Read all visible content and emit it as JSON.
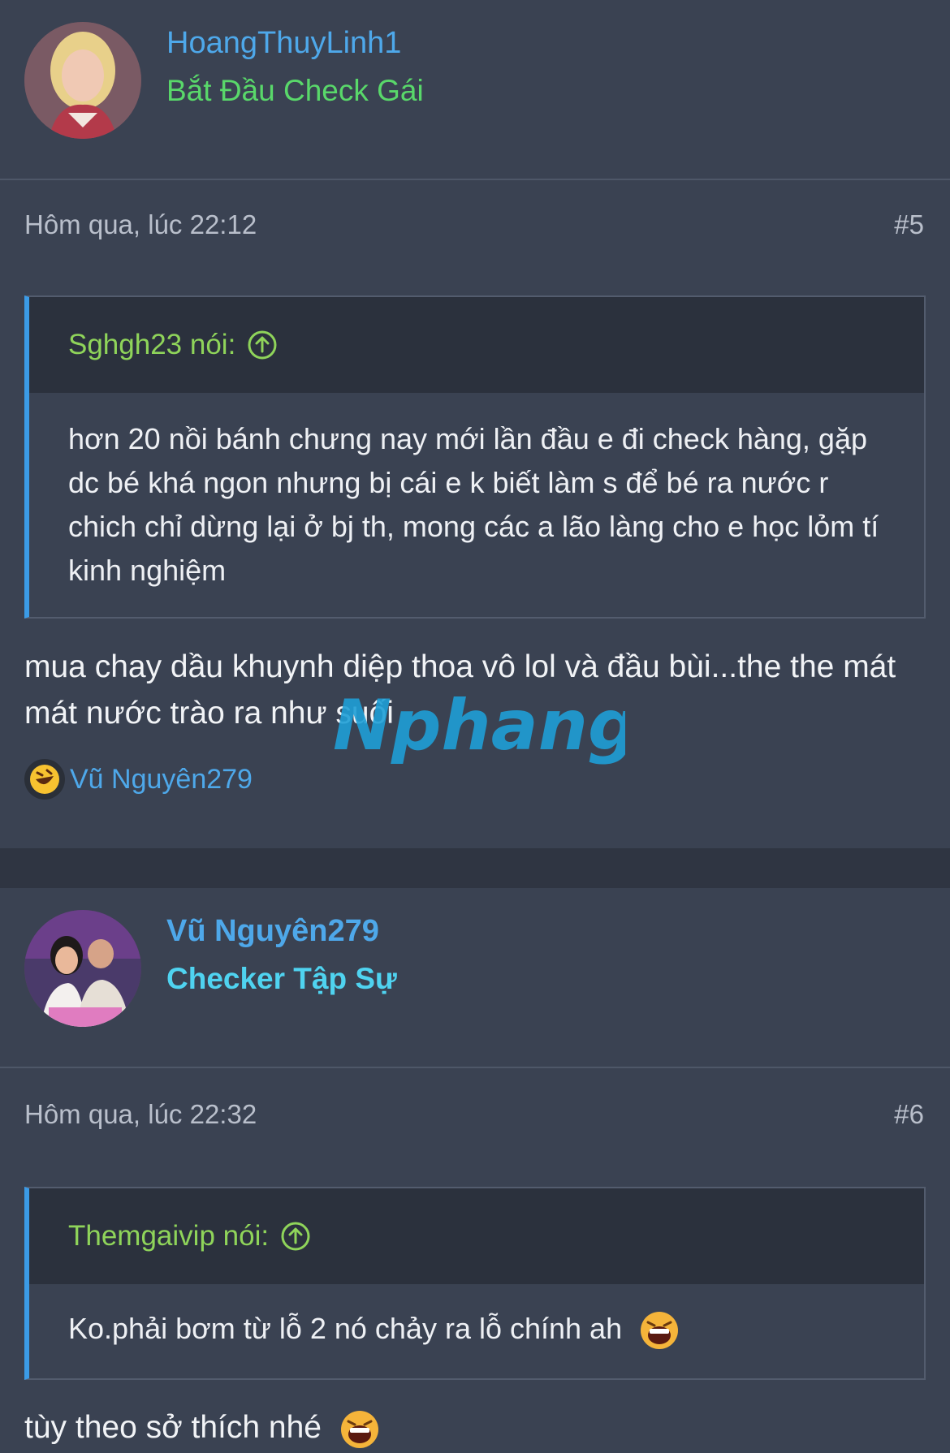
{
  "posts": [
    {
      "author": "HoangThuyLinh1",
      "user_title": "Bắt Đầu Check Gái",
      "date": "Hôm qua, lúc 22:12",
      "number": "#5",
      "quote": {
        "author_label": "Sghgh23 nói:",
        "text": "hơn 20 nồi bánh chưng nay mới lần đầu e đi check hàng, gặp dc bé khá ngon nhưng bị cái e k biết làm s để bé ra nước r chich chỉ dừng lại ở bj th, mong các a lão làng cho e học lỏm tí kinh nghiệm"
      },
      "body": "mua chay dầu khuynh diệp thoa vô lol và đầu bùi...the the mát mát nước trào ra như suối",
      "reaction_user": "Vũ Nguyên279"
    },
    {
      "author": "Vũ Nguyên279",
      "user_title": "Checker Tập Sự",
      "date": "Hôm qua, lúc 22:32",
      "number": "#6",
      "quote": {
        "author_label": "Themgaivip nói:",
        "text": "Ko.phải bơm từ lỗ 2 nó chảy ra lỗ chính ah"
      },
      "body": "tùy theo sở thích nhé"
    }
  ],
  "watermark": "Nphang",
  "colors": {
    "username": "#4ea8ea",
    "quote_author": "#8fd45a",
    "quote_border": "#3b9be6"
  }
}
